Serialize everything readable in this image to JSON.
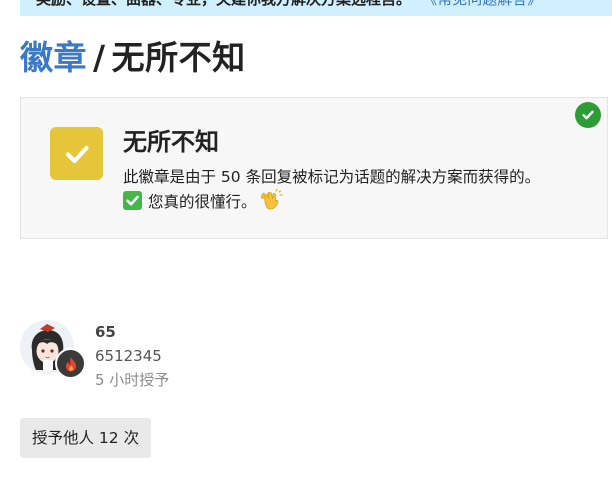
{
  "banner": {
    "text": "奖励、设置、曲器、专业，关建你我方解决方案选程宫。",
    "link": "《常见问题解答》"
  },
  "breadcrumb": {
    "section": "徽章",
    "separator": "/",
    "current": "无所不知"
  },
  "badge": {
    "name": "无所不知",
    "description_line1": "此徽章是由于 50 条回复被标记为话题的解决方案而获得的。",
    "description_line2": "您真的很懂行。",
    "icon": "checkmark-icon",
    "icon_color": "#e5c539",
    "granted_indicator": "check-circle-icon",
    "granted_color": "#2e9c36"
  },
  "recipient": {
    "username": "65",
    "title": "6512345",
    "granted_at": "5 小时授予",
    "flair_icon": "fire-icon"
  },
  "grant_others": {
    "label": "授予他人 12 次"
  },
  "colors": {
    "link": "#3b78c6",
    "banner_bg": "#d1f0ff"
  }
}
